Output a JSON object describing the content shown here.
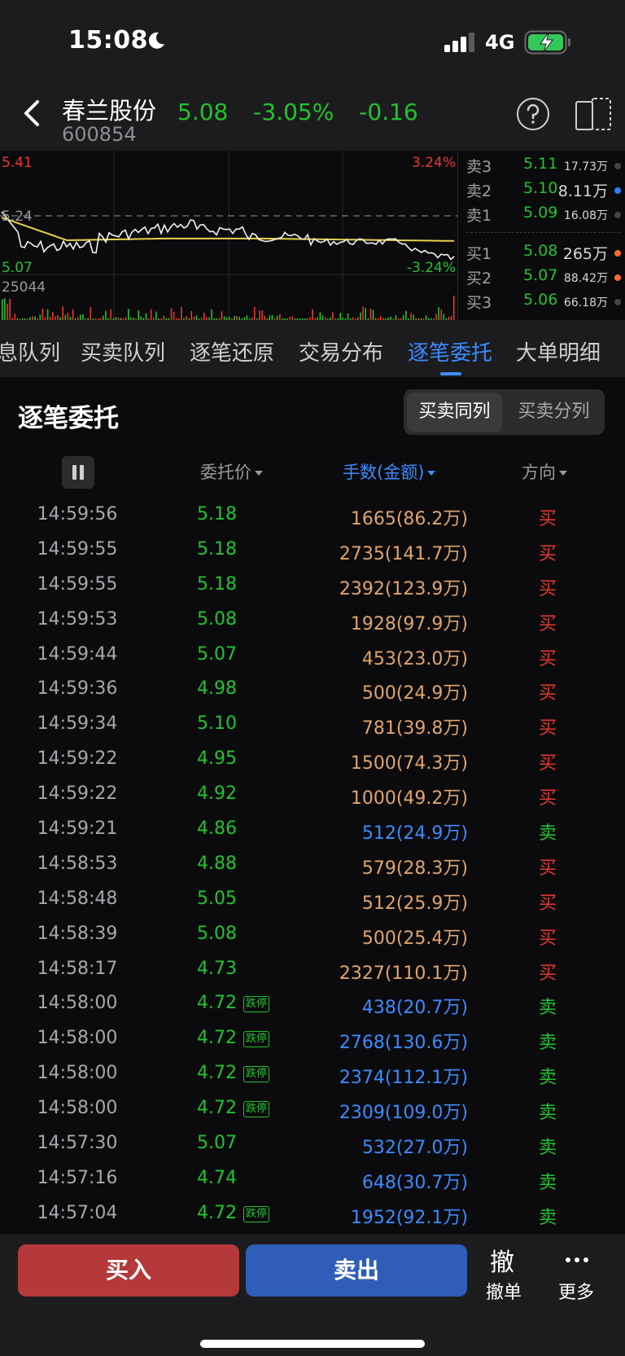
{
  "status_bar": {
    "time": "15:08",
    "network": "4G"
  },
  "header": {
    "stock_name": "春兰股份",
    "stock_code": "600854",
    "price": "5.08",
    "change_pct": "-3.05%",
    "change": "-0.16"
  },
  "chart": {
    "high_label": "5.41",
    "high_pct": "3.24%",
    "prev_close_label": "5.24",
    "low_label": "5.07",
    "low_pct": "-3.24%",
    "volume_label": "25044"
  },
  "orderbook": {
    "asks": [
      {
        "label": "卖3",
        "price": "5.11",
        "volume": "17.73万",
        "dot": "#444446"
      },
      {
        "label": "卖2",
        "price": "5.10",
        "volume": "8.11万",
        "dot": "#2f7cf6"
      },
      {
        "label": "卖1",
        "price": "5.09",
        "volume": "16.08万",
        "dot": "#444446"
      }
    ],
    "bids": [
      {
        "label": "买1",
        "price": "5.08",
        "volume": "265万",
        "dot": "#ff6a2b"
      },
      {
        "label": "买2",
        "price": "5.07",
        "volume": "88.42万",
        "dot": "#ff6a2b"
      },
      {
        "label": "买3",
        "price": "5.06",
        "volume": "66.18万",
        "dot": "#444446"
      }
    ]
  },
  "tabs": [
    {
      "label": "息队列",
      "active": false
    },
    {
      "label": "买卖队列",
      "active": false
    },
    {
      "label": "逐笔还原",
      "active": false
    },
    {
      "label": "交易分布",
      "active": false
    },
    {
      "label": "逐笔委托",
      "active": true
    },
    {
      "label": "大单明细",
      "active": false
    }
  ],
  "panel": {
    "title": "逐笔委托",
    "segment_on": "买卖同列",
    "segment_off": "买卖分列",
    "col_price": "委托价",
    "col_volume": "手数(金额)",
    "col_direction": "方向"
  },
  "colors": {
    "buy": "#e8382f",
    "sell": "#22c32e",
    "vol_buy": "#e0a46c",
    "vol_sell": "#3d8bff"
  },
  "orders": [
    {
      "time": "14:59:56",
      "price": "5.18",
      "tag": "",
      "volume": "1665(86.2万)",
      "dir": "买",
      "side": "buy"
    },
    {
      "time": "14:59:55",
      "price": "5.18",
      "tag": "",
      "volume": "2735(141.7万)",
      "dir": "买",
      "side": "buy"
    },
    {
      "time": "14:59:55",
      "price": "5.18",
      "tag": "",
      "volume": "2392(123.9万)",
      "dir": "买",
      "side": "buy"
    },
    {
      "time": "14:59:53",
      "price": "5.08",
      "tag": "",
      "volume": "1928(97.9万)",
      "dir": "买",
      "side": "buy"
    },
    {
      "time": "14:59:44",
      "price": "5.07",
      "tag": "",
      "volume": "453(23.0万)",
      "dir": "买",
      "side": "buy"
    },
    {
      "time": "14:59:36",
      "price": "4.98",
      "tag": "",
      "volume": "500(24.9万)",
      "dir": "买",
      "side": "buy"
    },
    {
      "time": "14:59:34",
      "price": "5.10",
      "tag": "",
      "volume": "781(39.8万)",
      "dir": "买",
      "side": "buy"
    },
    {
      "time": "14:59:22",
      "price": "4.95",
      "tag": "",
      "volume": "1500(74.3万)",
      "dir": "买",
      "side": "buy"
    },
    {
      "time": "14:59:22",
      "price": "4.92",
      "tag": "",
      "volume": "1000(49.2万)",
      "dir": "买",
      "side": "buy"
    },
    {
      "time": "14:59:21",
      "price": "4.86",
      "tag": "",
      "volume": "512(24.9万)",
      "dir": "卖",
      "side": "sell"
    },
    {
      "time": "14:58:53",
      "price": "4.88",
      "tag": "",
      "volume": "579(28.3万)",
      "dir": "买",
      "side": "buy"
    },
    {
      "time": "14:58:48",
      "price": "5.05",
      "tag": "",
      "volume": "512(25.9万)",
      "dir": "买",
      "side": "buy"
    },
    {
      "time": "14:58:39",
      "price": "5.08",
      "tag": "",
      "volume": "500(25.4万)",
      "dir": "买",
      "side": "buy"
    },
    {
      "time": "14:58:17",
      "price": "4.73",
      "tag": "",
      "volume": "2327(110.1万)",
      "dir": "买",
      "side": "buy"
    },
    {
      "time": "14:58:00",
      "price": "4.72",
      "tag": "跌停",
      "volume": "438(20.7万)",
      "dir": "卖",
      "side": "sell"
    },
    {
      "time": "14:58:00",
      "price": "4.72",
      "tag": "跌停",
      "volume": "2768(130.6万)",
      "dir": "卖",
      "side": "sell"
    },
    {
      "time": "14:58:00",
      "price": "4.72",
      "tag": "跌停",
      "volume": "2374(112.1万)",
      "dir": "卖",
      "side": "sell"
    },
    {
      "time": "14:58:00",
      "price": "4.72",
      "tag": "跌停",
      "volume": "2309(109.0万)",
      "dir": "卖",
      "side": "sell"
    },
    {
      "time": "14:57:30",
      "price": "5.07",
      "tag": "",
      "volume": "532(27.0万)",
      "dir": "卖",
      "side": "sell"
    },
    {
      "time": "14:57:16",
      "price": "4.74",
      "tag": "",
      "volume": "648(30.7万)",
      "dir": "卖",
      "side": "sell"
    },
    {
      "time": "14:57:04",
      "price": "4.72",
      "tag": "跌停",
      "volume": "1952(92.1万)",
      "dir": "卖",
      "side": "sell"
    }
  ],
  "bottom": {
    "buy_label": "买入",
    "sell_label": "卖出",
    "cancel_glyph": "撤",
    "cancel_label": "撤单",
    "more_label": "更多"
  }
}
